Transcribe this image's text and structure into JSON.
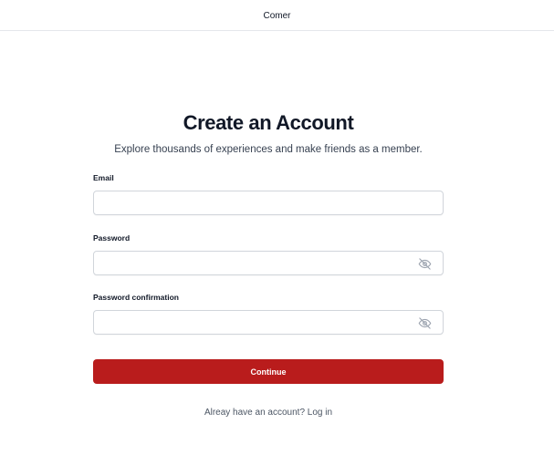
{
  "header": {
    "app_title": "Comer"
  },
  "form": {
    "title": "Create an Account",
    "subtitle": "Explore thousands of experiences and make friends as a member.",
    "email": {
      "label": "Email",
      "value": "",
      "placeholder": ""
    },
    "password": {
      "label": "Password",
      "value": "",
      "placeholder": "",
      "toggle_icon": "eye-off-icon"
    },
    "password_confirmation": {
      "label": "Password confirmation",
      "value": "",
      "placeholder": "",
      "toggle_icon": "eye-off-icon"
    },
    "submit_label": "Continue",
    "login_prompt": "Alreay have an account?",
    "login_link": "Log in"
  },
  "colors": {
    "primary_button": "#b91c1c",
    "border": "#d1d5db",
    "icon": "#9ca3af"
  }
}
